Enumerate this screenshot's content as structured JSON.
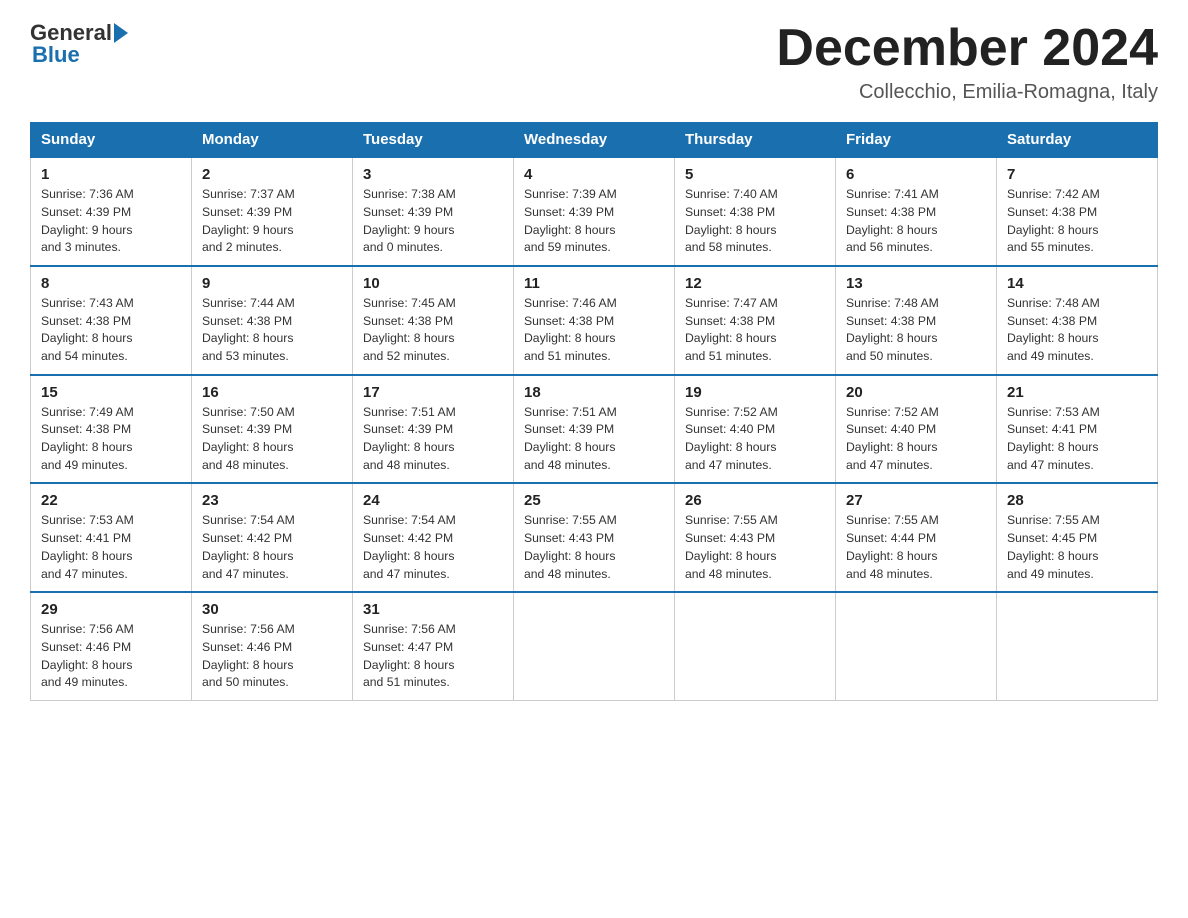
{
  "logo": {
    "general": "General",
    "blue": "Blue"
  },
  "title": "December 2024",
  "location": "Collecchio, Emilia-Romagna, Italy",
  "days_of_week": [
    "Sunday",
    "Monday",
    "Tuesday",
    "Wednesday",
    "Thursday",
    "Friday",
    "Saturday"
  ],
  "weeks": [
    [
      {
        "day": "1",
        "sunrise": "7:36 AM",
        "sunset": "4:39 PM",
        "daylight": "9 hours and 3 minutes."
      },
      {
        "day": "2",
        "sunrise": "7:37 AM",
        "sunset": "4:39 PM",
        "daylight": "9 hours and 2 minutes."
      },
      {
        "day": "3",
        "sunrise": "7:38 AM",
        "sunset": "4:39 PM",
        "daylight": "9 hours and 0 minutes."
      },
      {
        "day": "4",
        "sunrise": "7:39 AM",
        "sunset": "4:39 PM",
        "daylight": "8 hours and 59 minutes."
      },
      {
        "day": "5",
        "sunrise": "7:40 AM",
        "sunset": "4:38 PM",
        "daylight": "8 hours and 58 minutes."
      },
      {
        "day": "6",
        "sunrise": "7:41 AM",
        "sunset": "4:38 PM",
        "daylight": "8 hours and 56 minutes."
      },
      {
        "day": "7",
        "sunrise": "7:42 AM",
        "sunset": "4:38 PM",
        "daylight": "8 hours and 55 minutes."
      }
    ],
    [
      {
        "day": "8",
        "sunrise": "7:43 AM",
        "sunset": "4:38 PM",
        "daylight": "8 hours and 54 minutes."
      },
      {
        "day": "9",
        "sunrise": "7:44 AM",
        "sunset": "4:38 PM",
        "daylight": "8 hours and 53 minutes."
      },
      {
        "day": "10",
        "sunrise": "7:45 AM",
        "sunset": "4:38 PM",
        "daylight": "8 hours and 52 minutes."
      },
      {
        "day": "11",
        "sunrise": "7:46 AM",
        "sunset": "4:38 PM",
        "daylight": "8 hours and 51 minutes."
      },
      {
        "day": "12",
        "sunrise": "7:47 AM",
        "sunset": "4:38 PM",
        "daylight": "8 hours and 51 minutes."
      },
      {
        "day": "13",
        "sunrise": "7:48 AM",
        "sunset": "4:38 PM",
        "daylight": "8 hours and 50 minutes."
      },
      {
        "day": "14",
        "sunrise": "7:48 AM",
        "sunset": "4:38 PM",
        "daylight": "8 hours and 49 minutes."
      }
    ],
    [
      {
        "day": "15",
        "sunrise": "7:49 AM",
        "sunset": "4:38 PM",
        "daylight": "8 hours and 49 minutes."
      },
      {
        "day": "16",
        "sunrise": "7:50 AM",
        "sunset": "4:39 PM",
        "daylight": "8 hours and 48 minutes."
      },
      {
        "day": "17",
        "sunrise": "7:51 AM",
        "sunset": "4:39 PM",
        "daylight": "8 hours and 48 minutes."
      },
      {
        "day": "18",
        "sunrise": "7:51 AM",
        "sunset": "4:39 PM",
        "daylight": "8 hours and 48 minutes."
      },
      {
        "day": "19",
        "sunrise": "7:52 AM",
        "sunset": "4:40 PM",
        "daylight": "8 hours and 47 minutes."
      },
      {
        "day": "20",
        "sunrise": "7:52 AM",
        "sunset": "4:40 PM",
        "daylight": "8 hours and 47 minutes."
      },
      {
        "day": "21",
        "sunrise": "7:53 AM",
        "sunset": "4:41 PM",
        "daylight": "8 hours and 47 minutes."
      }
    ],
    [
      {
        "day": "22",
        "sunrise": "7:53 AM",
        "sunset": "4:41 PM",
        "daylight": "8 hours and 47 minutes."
      },
      {
        "day": "23",
        "sunrise": "7:54 AM",
        "sunset": "4:42 PM",
        "daylight": "8 hours and 47 minutes."
      },
      {
        "day": "24",
        "sunrise": "7:54 AM",
        "sunset": "4:42 PM",
        "daylight": "8 hours and 47 minutes."
      },
      {
        "day": "25",
        "sunrise": "7:55 AM",
        "sunset": "4:43 PM",
        "daylight": "8 hours and 48 minutes."
      },
      {
        "day": "26",
        "sunrise": "7:55 AM",
        "sunset": "4:43 PM",
        "daylight": "8 hours and 48 minutes."
      },
      {
        "day": "27",
        "sunrise": "7:55 AM",
        "sunset": "4:44 PM",
        "daylight": "8 hours and 48 minutes."
      },
      {
        "day": "28",
        "sunrise": "7:55 AM",
        "sunset": "4:45 PM",
        "daylight": "8 hours and 49 minutes."
      }
    ],
    [
      {
        "day": "29",
        "sunrise": "7:56 AM",
        "sunset": "4:46 PM",
        "daylight": "8 hours and 49 minutes."
      },
      {
        "day": "30",
        "sunrise": "7:56 AM",
        "sunset": "4:46 PM",
        "daylight": "8 hours and 50 minutes."
      },
      {
        "day": "31",
        "sunrise": "7:56 AM",
        "sunset": "4:47 PM",
        "daylight": "8 hours and 51 minutes."
      },
      null,
      null,
      null,
      null
    ]
  ],
  "labels": {
    "sunrise": "Sunrise:",
    "sunset": "Sunset:",
    "daylight": "Daylight:"
  }
}
